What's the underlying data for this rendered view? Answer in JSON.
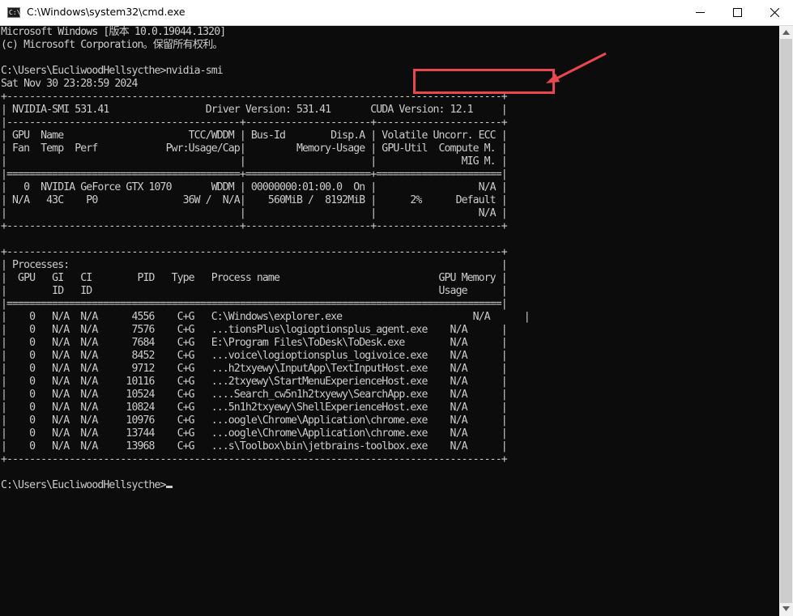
{
  "window": {
    "icon_text": "C:\\",
    "title": "C:\\Windows\\system32\\cmd.exe"
  },
  "terminal": {
    "lines": [
      "Microsoft Windows [版本 10.0.19044.1320]",
      "(c) Microsoft Corporation。保留所有权利。",
      "",
      "C:\\Users\\EucliwoodHellsycthe>nvidia-smi",
      "Sat Nov 30 23:28:59 2024",
      "+---------------------------------------------------------------------------------------+",
      "| NVIDIA-SMI 531.41                 Driver Version: 531.41       CUDA Version: 12.1     |",
      "|-----------------------------------------+----------------------+----------------------+",
      "| GPU  Name                      TCC/WDDM | Bus-Id        Disp.A | Volatile Uncorr. ECC |",
      "| Fan  Temp  Perf            Pwr:Usage/Cap|         Memory-Usage | GPU-Util  Compute M. |",
      "|                                         |                      |               MIG M. |",
      "|=========================================+======================+======================|",
      "|   0  NVIDIA GeForce GTX 1070       WDDM | 00000000:01:00.0  On |                  N/A |",
      "| N/A   43C    P0               36W /  N/A|    560MiB /  8192MiB |      2%      Default |",
      "|                                         |                      |                  N/A |",
      "+-----------------------------------------+----------------------+----------------------+",
      "",
      "+---------------------------------------------------------------------------------------+",
      "| Processes:                                                                            |",
      "|  GPU   GI   CI        PID   Type   Process name                            GPU Memory |",
      "|        ID   ID                                                             Usage      |",
      "|=======================================================================================|",
      "|    0   N/A  N/A      4556    C+G   C:\\Windows\\explorer.exe                       N/A      |",
      "|    0   N/A  N/A      7576    C+G   ...tionsPlus\\logioptionsplus_agent.exe    N/A      |",
      "|    0   N/A  N/A      7684    C+G   E:\\Program Files\\ToDesk\\ToDesk.exe        N/A      |",
      "|    0   N/A  N/A      8452    C+G   ...voice\\logioptionsplus_logivoice.exe    N/A      |",
      "|    0   N/A  N/A      9712    C+G   ...h2txyewy\\InputApp\\TextInputHost.exe    N/A      |",
      "|    0   N/A  N/A     10116    C+G   ...2txyewy\\StartMenuExperienceHost.exe    N/A      |",
      "|    0   N/A  N/A     10524    C+G   ....Search_cw5n1h2txyewy\\SearchApp.exe    N/A      |",
      "|    0   N/A  N/A     10824    C+G   ...5n1h2txyewy\\ShellExperienceHost.exe    N/A      |",
      "|    0   N/A  N/A     10976    C+G   ...oogle\\Chrome\\Application\\chrome.exe    N/A      |",
      "|    0   N/A  N/A     13744    C+G   ...oogle\\Chrome\\Application\\chrome.exe    N/A      |",
      "|    0   N/A  N/A     13968    C+G   ...s\\Toolbox\\bin\\jetbrains-toolbox.exe    N/A      |",
      "+---------------------------------------------------------------------------------------+",
      "",
      "C:\\Users\\EucliwoodHellsycthe>"
    ]
  },
  "colors": {
    "terminal_bg": "#0c0c0c",
    "terminal_fg": "#cccccc",
    "annotation": "#e9474f"
  }
}
